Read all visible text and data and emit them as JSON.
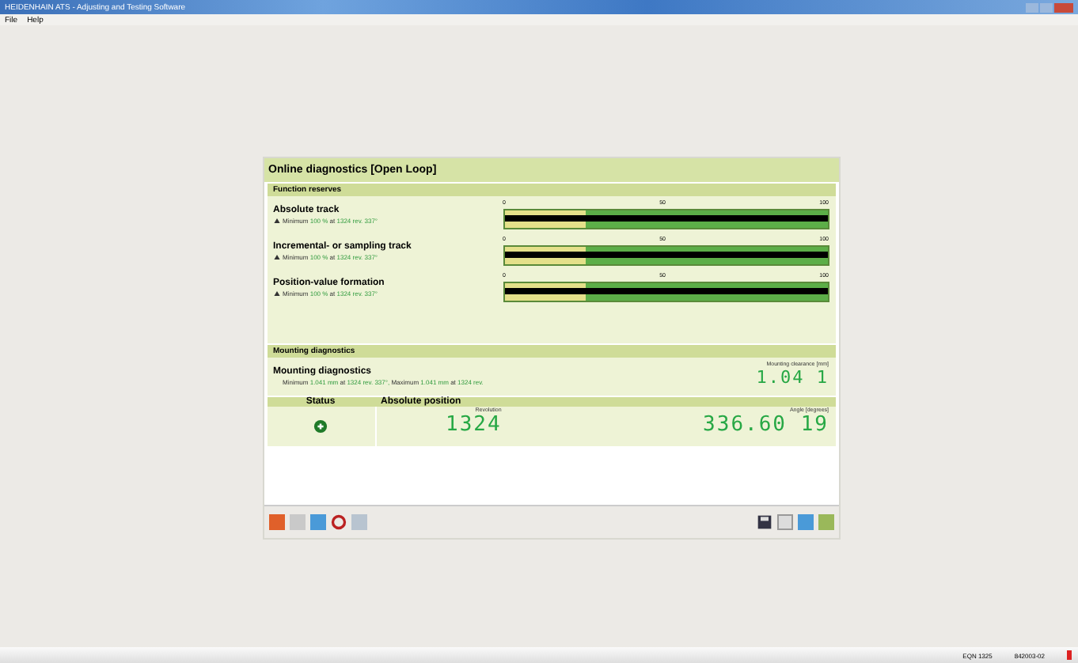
{
  "window": {
    "title": "HEIDENHAIN ATS - Adjusting and Testing Software"
  },
  "menu": [
    "File",
    "Help"
  ],
  "panel": {
    "title": "Online diagnostics [Open Loop]",
    "function_reserves": {
      "heading": "Function reserves",
      "rows": [
        {
          "name": "Absolute track",
          "prefix": "Minimum",
          "value": "100 %",
          "at": "at",
          "position": "1324 rev. 337°",
          "ticks": [
            "0",
            "50",
            "100"
          ],
          "level": 1
        },
        {
          "name": "Incremental- or sampling track",
          "prefix": "Minimum",
          "value": "100 %",
          "at": "at",
          "position": "1324 rev. 337°",
          "ticks": [
            "0",
            "50",
            "100"
          ],
          "level": 1
        },
        {
          "name": "Position-value formation",
          "prefix": "Minimum",
          "value": "100 %",
          "at": "at",
          "position": "1324 rev. 337°",
          "ticks": [
            "0",
            "50",
            "100"
          ],
          "level": 1
        }
      ]
    },
    "mounting": {
      "heading": "Mounting diagnostics",
      "name": "Mounting diagnostics",
      "prefix": "Minimum",
      "min_value": "1.041 mm",
      "at": "at",
      "min_position": "1324 rev. 337°,",
      "max_prefix": "Maximum",
      "max_value": "1.041 mm",
      "at2": "at",
      "max_position": "1324 rev.",
      "reading_label": "Mounting clearance [mm]",
      "reading": "1.04 1"
    },
    "position": {
      "status_heading": "Status",
      "heading": "Absolute position",
      "status_ok": true,
      "revolution_label": "Revolution",
      "revolution": "1324",
      "angle_label": "Angle [degrees]",
      "angle": "336.60 19"
    }
  },
  "status_bar": [
    "EQN 1325",
    "842003-02"
  ]
}
